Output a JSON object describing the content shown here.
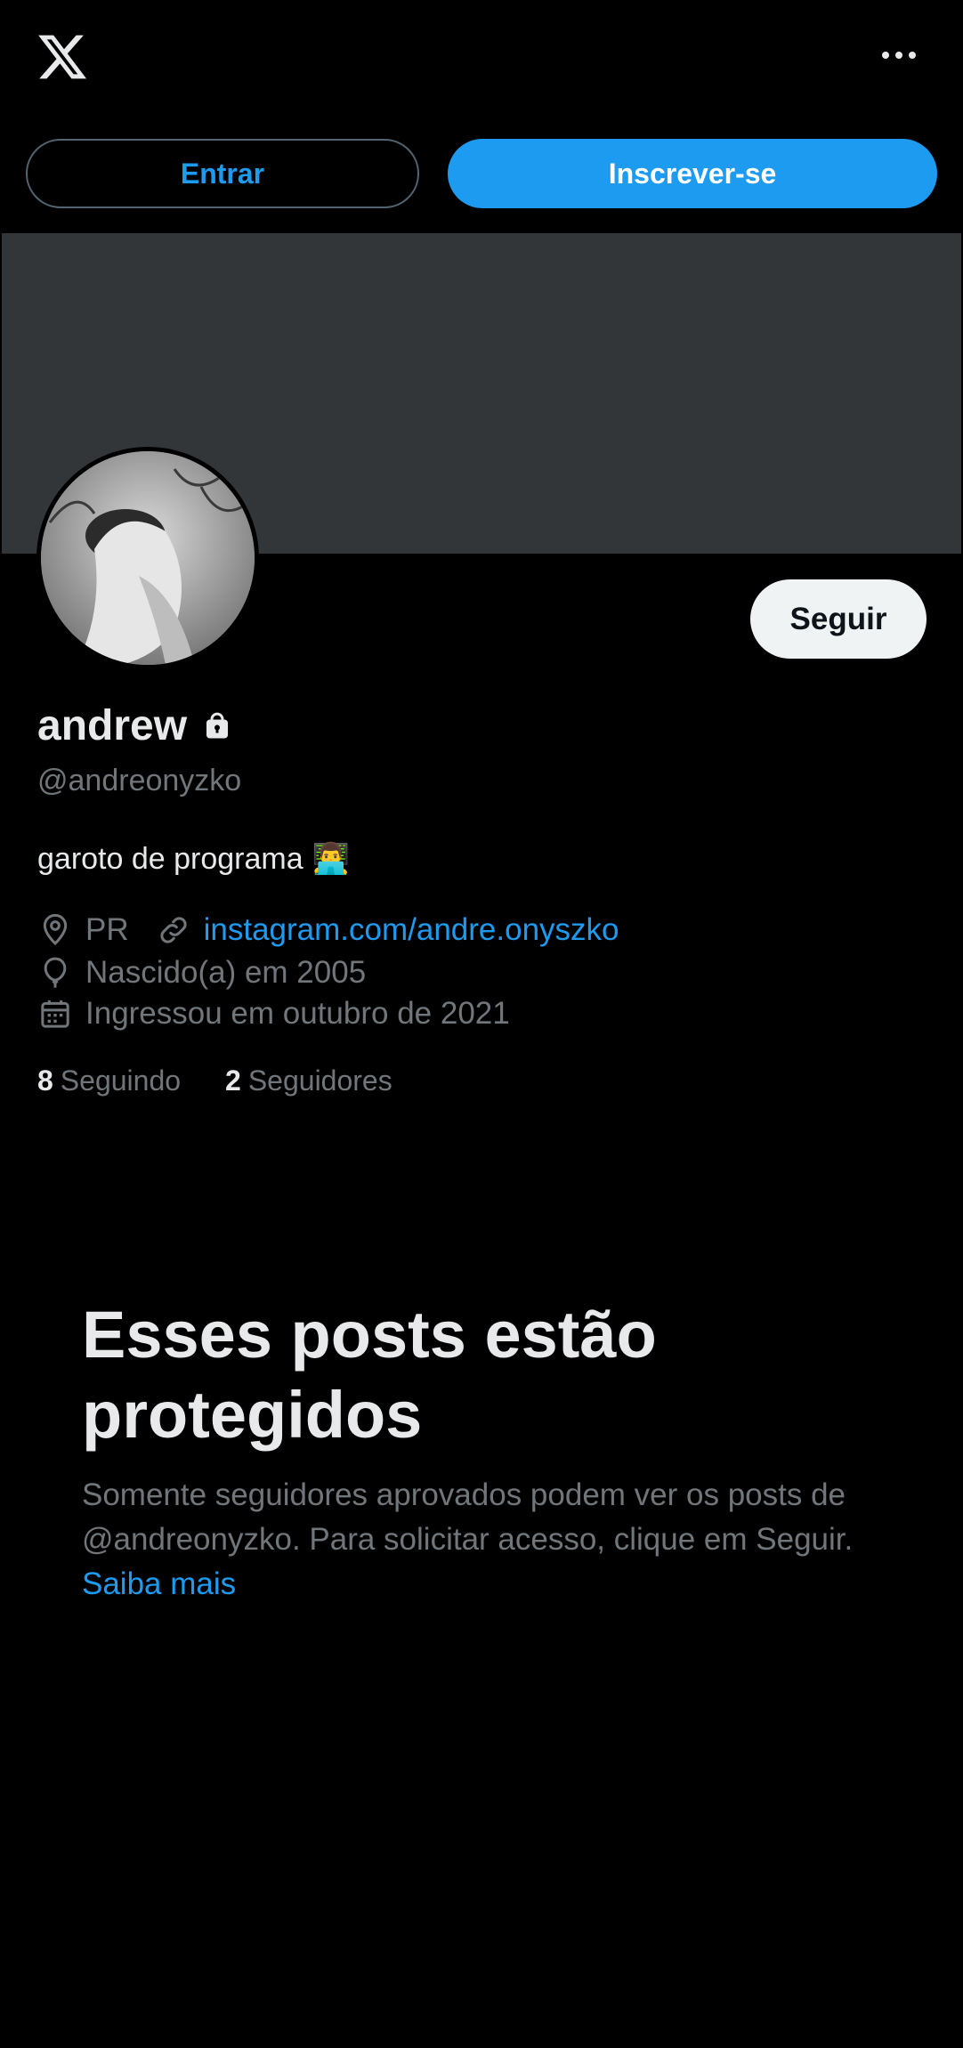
{
  "header": {
    "logo": "x-logo-icon",
    "more": "more-icon"
  },
  "auth": {
    "login_label": "Entrar",
    "signup_label": "Inscrever-se"
  },
  "profile": {
    "display_name": "andrew",
    "handle": "@andreonyzko",
    "bio": "garoto de programa",
    "bio_emoji": "👨‍💻",
    "follow_label": "Seguir",
    "location": "PR",
    "website": "instagram.com/andre.onyszko",
    "birth": "Nascido(a) em 2005",
    "joined": "Ingressou em outubro de 2021",
    "following_count": "8",
    "following_label": "Seguindo",
    "followers_count": "2",
    "followers_label": "Seguidores"
  },
  "protected": {
    "title": "Esses posts estão protegidos",
    "body": "Somente seguidores aprovados podem ver os posts de @andreonyzko. Para solicitar acesso, clique em Seguir.",
    "learn_more": "Saiba mais"
  },
  "colors": {
    "accent": "#1d9bf0",
    "background": "#000000",
    "banner": "#333639",
    "muted": "#71767b"
  }
}
